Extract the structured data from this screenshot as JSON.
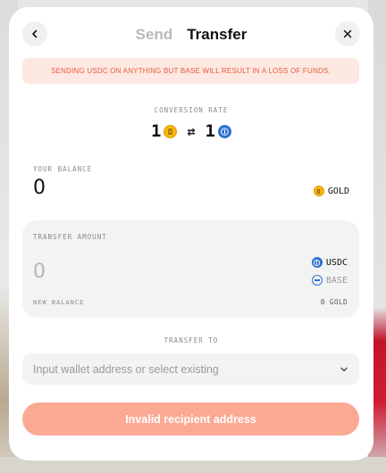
{
  "header": {
    "tabs": [
      "Send",
      "Transfer"
    ],
    "active_tab": "Transfer"
  },
  "warning": "SENDING USDC ON ANYTHING BUT BASE WILL RESULT IN A LOSS OF FUNDS.",
  "conversion": {
    "label": "CONVERSION RATE",
    "left_amount": "1",
    "right_amount": "1",
    "swap_symbol": "⇄"
  },
  "balance": {
    "label": "YOUR BALANCE",
    "value": "0",
    "token": "GOLD"
  },
  "transfer": {
    "label": "TRANSFER AMOUNT",
    "value": "0",
    "token": "USDC",
    "network": "BASE",
    "new_balance_label": "NEW BALANCE",
    "new_balance_value": "0 GOLD"
  },
  "recipient": {
    "label": "TRANSFER TO",
    "placeholder": "Input wallet address or select existing"
  },
  "submit_label": "Invalid recipient address",
  "colors": {
    "accent": "#fca994",
    "warning_bg": "#fde8e2",
    "warning_text": "#ea5b3c",
    "gold": "#f5b813",
    "usdc": "#2e6fd0"
  },
  "icons": {
    "back": "chevron-left-icon",
    "close": "close-icon",
    "gold": "gold-coin-icon",
    "usdc": "usdc-coin-icon",
    "base": "base-network-icon",
    "dropdown": "chevron-down-icon"
  }
}
